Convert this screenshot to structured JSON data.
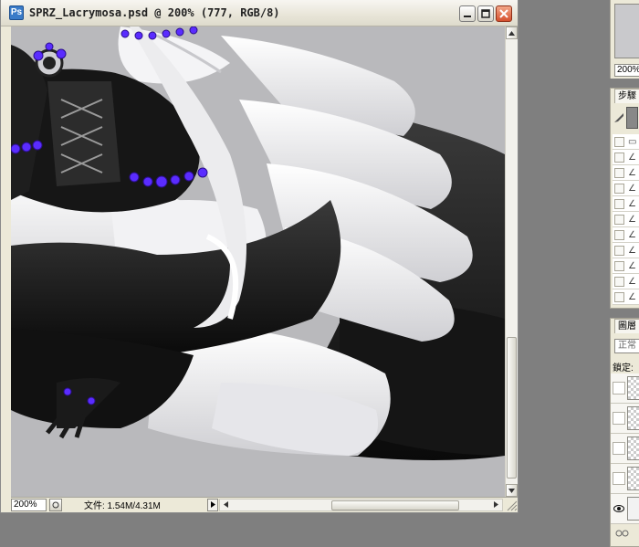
{
  "document_window": {
    "title": "SPRZ_Lacrymosa.psd @ 200% (777, RGB/8)",
    "zoom": "200%",
    "doc_info": "文件: 1.54M/4.31M",
    "buttons": [
      "minimize",
      "maximize",
      "close"
    ]
  },
  "navigator_panel": {
    "zoom": "200%"
  },
  "history_panel": {
    "tab_label": "步驟",
    "snapshot_icon": "brush-icon",
    "rows": [
      {
        "icon": "document-icon"
      },
      {
        "icon": "brush-stroke-icon"
      },
      {
        "icon": "brush-stroke-icon"
      },
      {
        "icon": "brush-stroke-icon"
      },
      {
        "icon": "brush-stroke-icon"
      },
      {
        "icon": "brush-stroke-icon"
      },
      {
        "icon": "brush-stroke-icon"
      },
      {
        "icon": "brush-stroke-icon"
      },
      {
        "icon": "brush-stroke-icon"
      },
      {
        "icon": "brush-stroke-icon"
      },
      {
        "icon": "brush-stroke-icon"
      }
    ]
  },
  "layers_panel": {
    "tab_label": "圖層",
    "blend_mode": "正常",
    "lock_label": "鎖定:",
    "layers": [
      {
        "visible": false
      },
      {
        "visible": false
      },
      {
        "visible": false
      },
      {
        "visible": false
      },
      {
        "visible": true
      }
    ]
  },
  "colors": {
    "workspace": "#7f7f7f",
    "accent_purple": "#5a2cff"
  }
}
